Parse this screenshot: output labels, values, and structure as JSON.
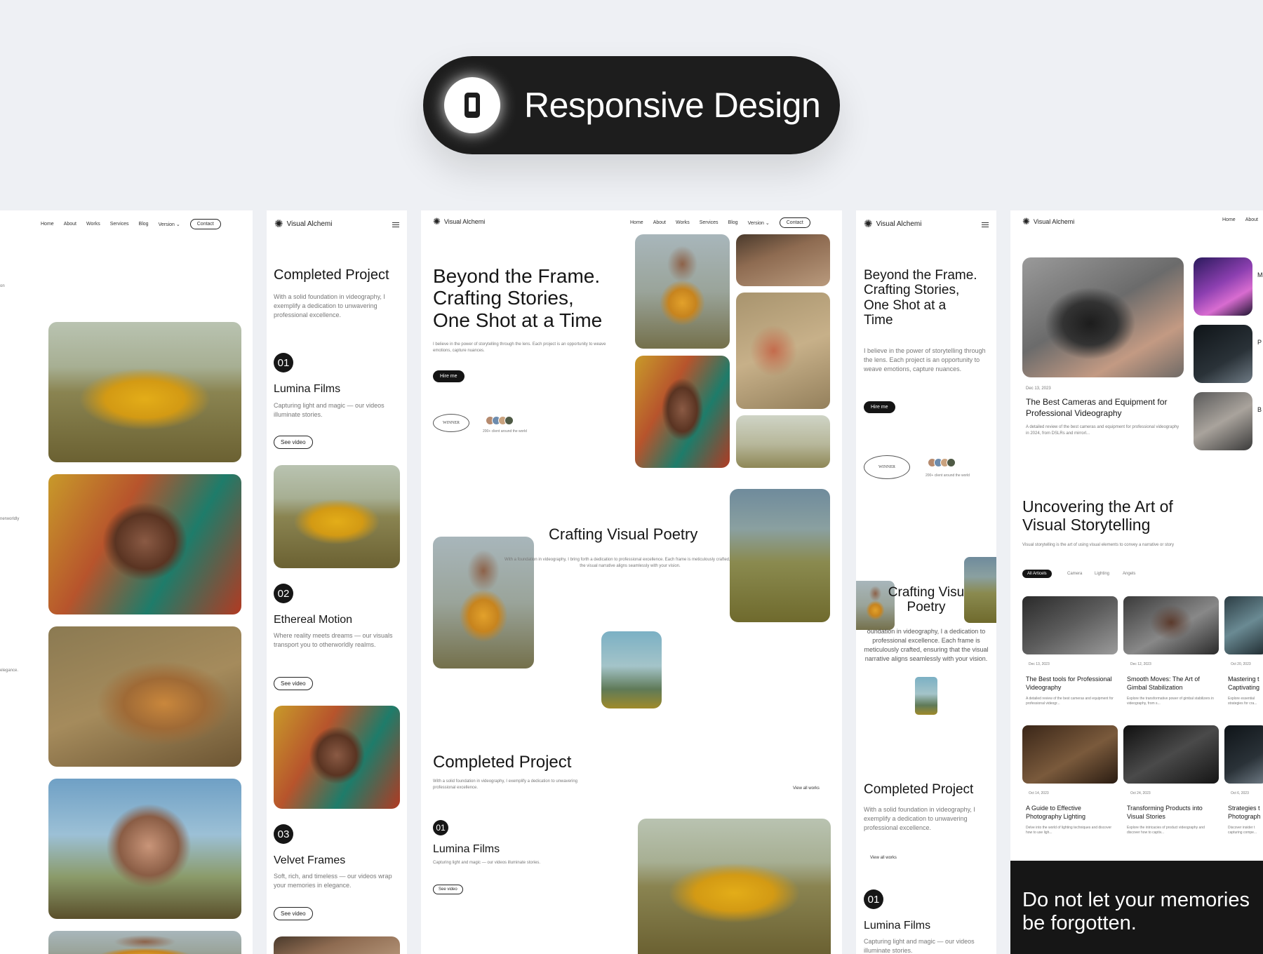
{
  "badge": {
    "label": "Responsive Design",
    "icon": "mobile-phone-icon"
  },
  "nav": {
    "home": "Home",
    "about": "About",
    "works": "Works",
    "services": "Services",
    "blog": "Blog",
    "version": "Version",
    "contact": "Contact"
  },
  "brand": {
    "name": "Visual Alchemi",
    "icon": "sparkle-icon"
  },
  "panel1": {
    "caption1": "on",
    "caption2": "nerworldly",
    "caption3": "elegance."
  },
  "completed": {
    "title": "Completed Project",
    "desc": "With a solid foundation in videography, I exemplify a dedication to unwavering professional excellence.",
    "view_all": "View all works",
    "projects": [
      {
        "num": "01",
        "title": "Lumina Films",
        "desc": "Capturing light and magic — our videos illuminate stories.",
        "cta": "See video"
      },
      {
        "num": "02",
        "title": "Ethereal Motion",
        "desc": "Where reality meets dreams — our visuals transport you to otherworldly realms.",
        "cta": "See video"
      },
      {
        "num": "03",
        "title": "Velvet Frames",
        "desc": "Soft, rich, and timeless — our videos wrap your memories in elegance.",
        "cta": "See video"
      }
    ]
  },
  "hero": {
    "line1": "Beyond the Frame.",
    "line2": "Crafting Stories,",
    "line3": "One Shot at a Time",
    "desc": "I believe in the power of storytelling through the lens. Each project is an opportunity to weave emotions, capture nuances.",
    "cta": "Hire me",
    "winner": "WINNER",
    "clients": "200+ client around the world"
  },
  "poetry": {
    "title": "Crafting Visual Poetry",
    "desc": "With a foundation in videography, I bring forth a dedication to professional excellence. Each frame is meticulously crafted, ensuring that the visual narrative aligns seamlessly with your vision."
  },
  "mobile": {
    "hero_line1": "Beyond the Frame.",
    "hero_line2": "Crafting Stories,",
    "hero_line3": "One Shot at a",
    "hero_line4": "Time",
    "hero_desc": "I believe in the power of storytelling through the lens. Each project is an opportunity to weave emotions, capture nuances.",
    "poetry_line1": "Crafting Visu",
    "poetry_line2": "Poetry",
    "poetry_desc": "oundation in videography, I a dedication to professional excellence. Each frame is meticulously crafted, ensuring that the visual narrative aligns seamlessly with your vision."
  },
  "blog": {
    "featured": {
      "date": "Dec 13, 2023",
      "title": "The Best Cameras and Equipment for Professional Videography",
      "desc": "A detailed review of the best cameras and equipment for professional videography in 2024, from DSLRs and mirrorl..."
    },
    "side_letters": [
      "M",
      "P",
      "B"
    ],
    "section_line1": "Uncovering the Art of",
    "section_line2": "Visual Storytelling",
    "section_desc": "Visual storytelling is the art of using visual elements to convey a narrative or story",
    "filters": [
      "All Articels",
      "Camera",
      "Lighting",
      "Angels"
    ],
    "cards": [
      {
        "date": "Dec 13, 2023",
        "title": "The Best tools for Professional Videography",
        "desc": "A detailed review of the best cameras and equipment for professional videogr..."
      },
      {
        "date": "Dec 12, 2023",
        "title": "Smooth Moves: The Art of Gimbal Stabilization",
        "desc": "Explore the transformative power of gimbal stabilizers in videography, from s..."
      },
      {
        "date": "Oct 20, 2023",
        "title": "Mastering t Captivating",
        "desc": "Explore essential strategies for cra..."
      },
      {
        "date": "Oct 14, 2023",
        "title": "A Guide to Effective Photography Lighting",
        "desc": "Delve into the world of lighting techniques and discover how to use ligh..."
      },
      {
        "date": "Oct 24, 2023",
        "title": "Transforming Products into Visual Stories",
        "desc": "Explore the intricacies of product videography and discover how to captiv..."
      },
      {
        "date": "Oct 6, 2023",
        "title": "Strategies t Photograph",
        "desc": "Discover insider t capturing compe..."
      }
    ],
    "cta_line1": "Do not let your memories",
    "cta_line2": "be forgotten."
  }
}
